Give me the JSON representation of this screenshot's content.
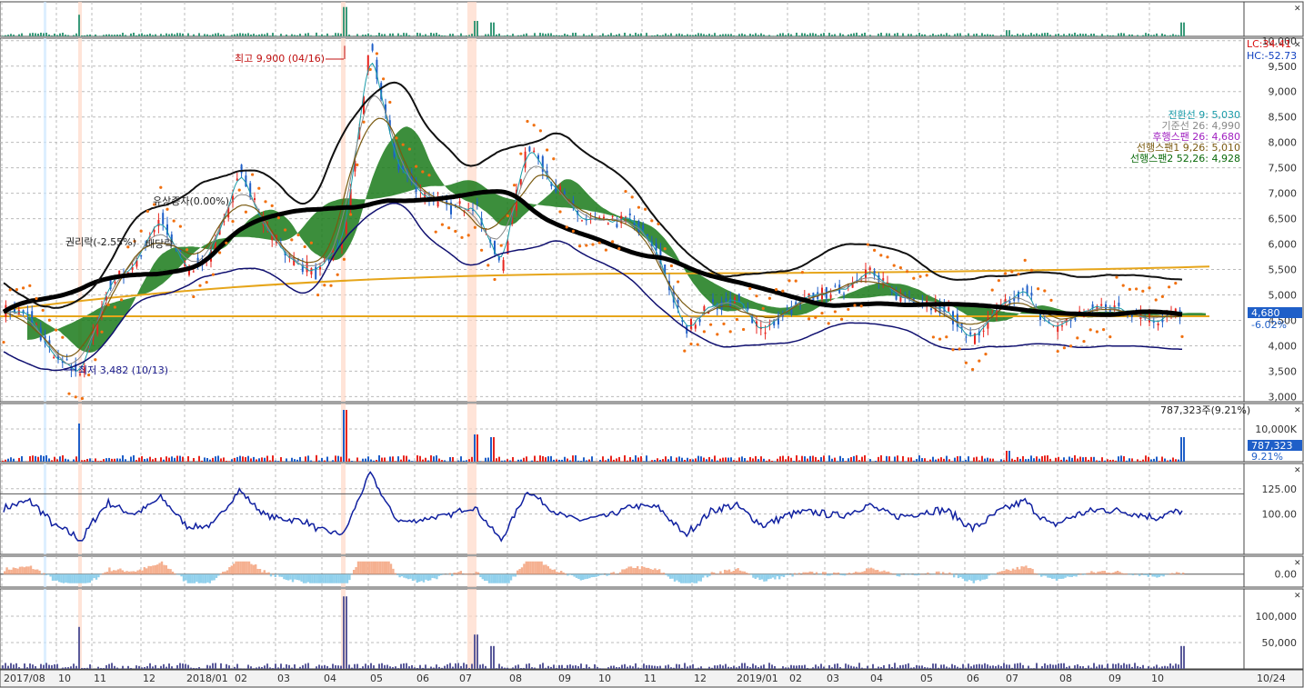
{
  "chart_data": {
    "type": "line",
    "x_axis": {
      "ticks": [
        "2017/08",
        "10",
        "11",
        "12",
        "2018/01",
        "02",
        "03",
        "04",
        "05",
        "06",
        "07",
        "08",
        "09",
        "10",
        "11",
        "12",
        "2019/01",
        "02",
        "03",
        "04",
        "05",
        "06",
        "07",
        "08",
        "09",
        "10"
      ],
      "current_date": "10/24"
    },
    "price": {
      "yticks": [
        "10,000",
        "9,500",
        "9,000",
        "8,500",
        "8,000",
        "7,500",
        "7,000",
        "6,500",
        "6,000",
        "5,500",
        "5,000",
        "4,500",
        "4,000",
        "3,500",
        "3,000"
      ],
      "ylim": [
        2900,
        10050
      ],
      "lc_label": "LC:34.41",
      "hc_label": "HC:-52.73",
      "high_label": "최고 9,900 (04/16)",
      "low_label": "최저 3,482 (10/13)",
      "event_rights_issue": "유상증자(0.00%)",
      "event_ex_rights": "권리락(-2.55%)",
      "event_ex_dividend": "배당락",
      "current_price": "4,680",
      "current_change": "-6.02%",
      "ichimoku_legend": [
        {
          "text": "전환선 9: 5,030",
          "color": "#1a9ba8"
        },
        {
          "text": "기준선 26: 4,990",
          "color": "#888888"
        },
        {
          "text": "후행스팬 26: 4,680",
          "color": "#a020c0"
        },
        {
          "text": "선행스팬1 9,26: 5,010",
          "color": "#7a5a10"
        },
        {
          "text": "선행스팬2 52,26: 4,928",
          "color": "#0a6a0a"
        }
      ],
      "close_series": [
        [
          "2017/08",
          4700
        ],
        [
          "2017/09",
          4600
        ],
        [
          "2017/10",
          3700
        ],
        [
          "2017/10",
          3482
        ],
        [
          "2017/11",
          5200
        ],
        [
          "2017/11",
          5600
        ],
        [
          "2017/12",
          6500
        ],
        [
          "2017/12",
          5500
        ],
        [
          "2018/01",
          5800
        ],
        [
          "2018/02",
          7500
        ],
        [
          "2018/02",
          6300
        ],
        [
          "2018/03",
          5700
        ],
        [
          "2018/03",
          5400
        ],
        [
          "2018/04",
          6100
        ],
        [
          "2018/04",
          9900
        ],
        [
          "2018/05",
          7600
        ],
        [
          "2018/05",
          7000
        ],
        [
          "2018/06",
          6700
        ],
        [
          "2018/06",
          6800
        ],
        [
          "2018/07",
          5500
        ],
        [
          "2018/07",
          8000
        ],
        [
          "2018/08",
          7200
        ],
        [
          "2018/08",
          6500
        ],
        [
          "2018/09",
          6400
        ],
        [
          "2018/10",
          6500
        ],
        [
          "2018/10",
          5800
        ],
        [
          "2018/11",
          4300
        ],
        [
          "2018/11",
          4800
        ],
        [
          "2018/12",
          4900
        ],
        [
          "2018/12",
          4300
        ],
        [
          "2019/01",
          4700
        ],
        [
          "2019/02",
          5000
        ],
        [
          "2019/03",
          5100
        ],
        [
          "2019/03",
          5500
        ],
        [
          "2019/04",
          5000
        ],
        [
          "2019/05",
          4900
        ],
        [
          "2019/05",
          4700
        ],
        [
          "2019/06",
          4100
        ],
        [
          "2019/07",
          4700
        ],
        [
          "2019/07",
          5100
        ],
        [
          "2019/08",
          4300
        ],
        [
          "2019/08",
          4600
        ],
        [
          "2019/09",
          4800
        ],
        [
          "2019/09",
          4700
        ],
        [
          "2019/10",
          4500
        ],
        [
          "2019/10",
          4680
        ]
      ]
    },
    "volume": {
      "label": "787,323주(9.21%)",
      "yticks": [
        "10,000K"
      ],
      "current_value": "787,323",
      "current_pct": "9.21%"
    },
    "oscillator1": {
      "yticks": [
        "125.00",
        "100.00"
      ],
      "ylim": [
        60,
        150
      ],
      "reference": 120
    },
    "oscillator2": {
      "yticks": [
        "0.00"
      ]
    },
    "oscillator3": {
      "yticks": [
        "100,000",
        "50,000"
      ]
    },
    "colors": {
      "up": "#e8261f",
      "down": "#1f5fc8",
      "cloud": "#1a7a1a",
      "ma_thick": "#000000",
      "ma_gold": "#e6a51a",
      "osc_line": "#1020a0",
      "parabolic": "#f07010",
      "legend_lc": "#d81010",
      "legend_hc": "#1040c0",
      "current_price_bg": "#1f5fc8"
    }
  }
}
